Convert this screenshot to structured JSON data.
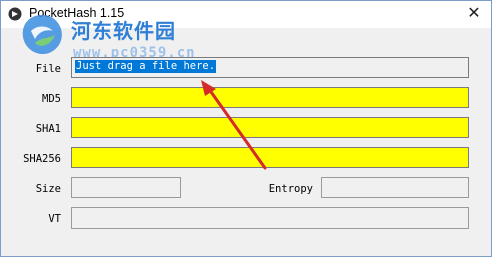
{
  "window": {
    "title": "PocketHash 1.15",
    "close_label": "✕"
  },
  "watermark": {
    "site_name": "河东软件园",
    "url": "www.pc0359.cn"
  },
  "fields": {
    "file": {
      "label": "File",
      "value": "Just drag a file here."
    },
    "md5": {
      "label": "MD5",
      "value": ""
    },
    "sha1": {
      "label": "SHA1",
      "value": ""
    },
    "sha256": {
      "label": "SHA256",
      "value": ""
    },
    "size": {
      "label": "Size",
      "value": ""
    },
    "entropy": {
      "label": "Entropy",
      "value": ""
    },
    "vt": {
      "label": "VT",
      "value": ""
    }
  },
  "colors": {
    "hash_field_bg": "#ffff00",
    "selection": "#0078d7",
    "annotation_arrow": "#d42a2a",
    "watermark_text": "#2f7fd6"
  },
  "icons": {
    "app": "pockethash-app-icon",
    "close": "close-icon",
    "watermark_logo": "watermark-logo",
    "annotation": "red-arrow"
  }
}
